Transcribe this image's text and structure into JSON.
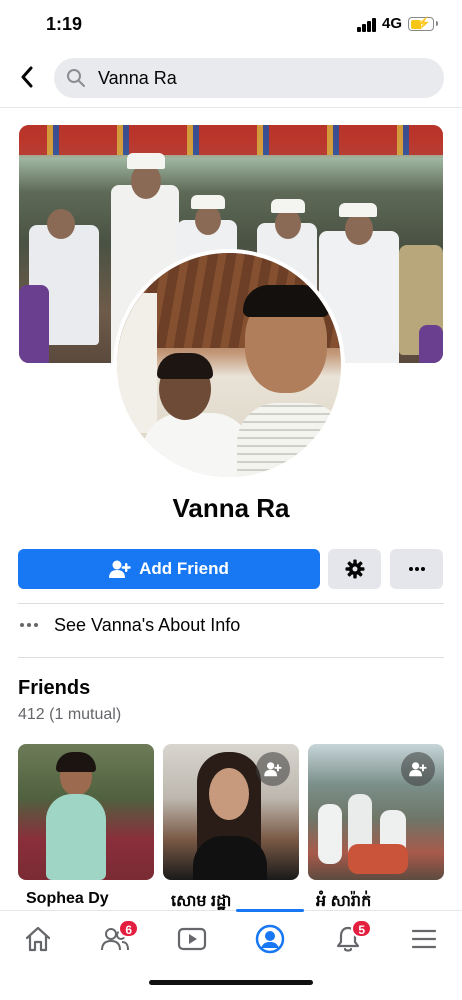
{
  "status_bar": {
    "time": "1:19",
    "network": "4G",
    "battery_level": 0.45
  },
  "header": {
    "search_value": "Vanna Ra",
    "icons": [
      "back-arrow-icon",
      "search-icon"
    ]
  },
  "profile": {
    "name": "Vanna Ra",
    "add_friend_label": "Add Friend",
    "about_label": "See Vanna's About Info"
  },
  "friends": {
    "title": "Friends",
    "count_text": "412 (1 mutual)",
    "cards": [
      {
        "name": "Sophea Dy",
        "has_add_badge": false
      },
      {
        "name": "សោម រដ្ឋា",
        "has_add_badge": true
      },
      {
        "name": "អំ សារ៉ាក់",
        "has_add_badge": true
      }
    ]
  },
  "bottom_nav": {
    "items": [
      "home-icon",
      "friends-icon",
      "watch-icon",
      "profile-icon",
      "notifications-icon",
      "menu-icon"
    ],
    "friends_badge": "6",
    "notifications_badge": "5",
    "active": "profile-icon"
  },
  "colors": {
    "accent": "#1877f2",
    "badge": "#e41e3f",
    "secondary_button": "#e4e6eb",
    "secondary_text": "#65676b"
  }
}
